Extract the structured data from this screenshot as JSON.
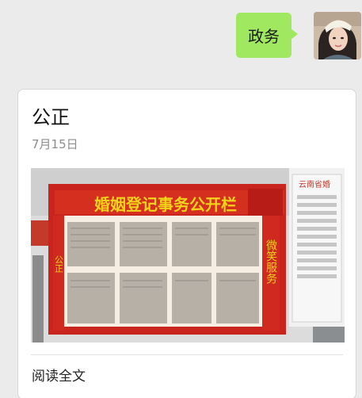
{
  "outgoing_message": {
    "text": "政务",
    "sender_avatar": "user-avatar-photo"
  },
  "article_card": {
    "title": "公正",
    "date": "7月15日",
    "cover_image": {
      "board_title": "婚姻登记事务公开栏",
      "right_panel_header": "云南省婚",
      "left_vertical_text": "公正",
      "right_vertical_text": "微笑服务"
    },
    "read_more_label": "阅读全文"
  },
  "colors": {
    "chat_background": "#ebebeb",
    "outgoing_bubble": "#9fe85f",
    "board_red": "#d12a22",
    "board_gold": "#f2d21a"
  }
}
